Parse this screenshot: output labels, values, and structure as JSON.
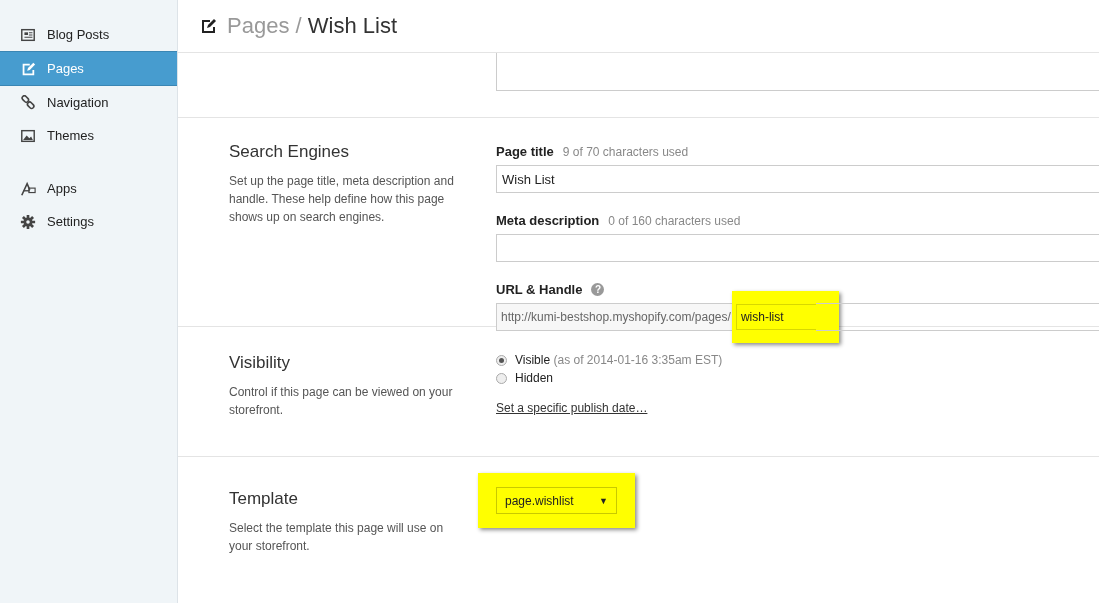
{
  "sidebar": {
    "groups": [
      [
        {
          "label": "Blog Posts",
          "selected": false
        },
        {
          "label": "Pages",
          "selected": true
        },
        {
          "label": "Navigation",
          "selected": false
        },
        {
          "label": "Themes",
          "selected": false
        }
      ],
      [
        {
          "label": "Apps",
          "selected": false
        },
        {
          "label": "Settings",
          "selected": false
        }
      ]
    ]
  },
  "header": {
    "breadcrumb": "Pages",
    "separator": "/",
    "title": "Wish List"
  },
  "sections": [
    {
      "kind": "search",
      "heading": "Search Engines",
      "description": "Set up the page title, meta description and handle. These help define how this page shows up on search engines.",
      "page_title": {
        "label": "Page title",
        "hint": "9 of 70 characters used",
        "value": "Wish List"
      },
      "meta_description": {
        "label": "Meta description",
        "hint": "0 of 160 characters used"
      },
      "url_handle": {
        "label": "URL & Handle",
        "help": "?",
        "prefix": "http://kumi-bestshop.myshopify.com/pages/",
        "value": "wish-list",
        "highlighted": true
      }
    },
    {
      "kind": "visibility",
      "heading": "Visibility",
      "description": "Control if this page can be viewed on your storefront.",
      "options": [
        {
          "label": "Visible",
          "note": "(as of 2014-01-16 3:35am EST)",
          "selected": true
        },
        {
          "label": "Hidden",
          "selected": false
        }
      ],
      "link": "Set a specific publish date…"
    },
    {
      "kind": "template",
      "heading": "Template",
      "description": "Select the template this page will use on your storefront.",
      "select": {
        "value": "page.wishlist",
        "caret": "▼",
        "highlighted": true
      }
    }
  ]
}
